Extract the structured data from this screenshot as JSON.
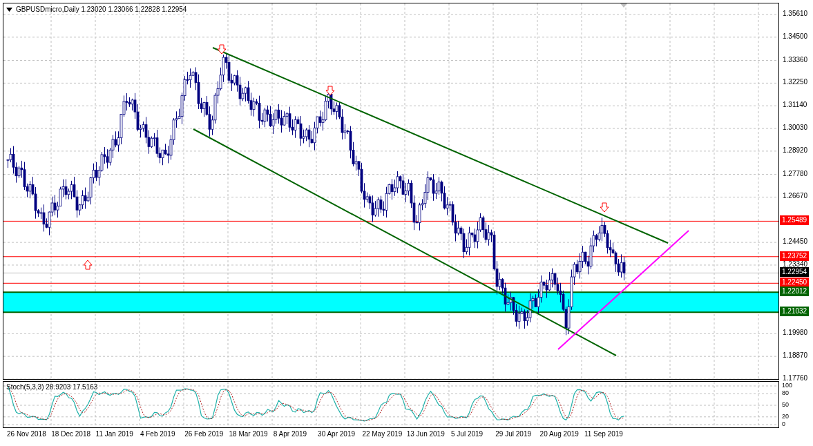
{
  "chart": {
    "title": "GBPUSDmicro,Daily  1.23020 1.23066 1.22828 1.22954",
    "price_axis": [
      "1.35610",
      "1.34500",
      "1.33360",
      "1.32250",
      "1.31140",
      "1.30030",
      "1.28920",
      "1.27780",
      "1.26670",
      "1.24450",
      "1.23340",
      "1.19980",
      "1.18870",
      "1.17760"
    ],
    "price_tags": [
      {
        "text": "1.25489",
        "kind": "level",
        "color": "#ff0000"
      },
      {
        "text": "1.23752",
        "kind": "level",
        "color": "#ff0000"
      },
      {
        "text": "1.22954",
        "kind": "bid",
        "color": "#000000"
      },
      {
        "text": "1.22450",
        "kind": "level",
        "color": "#ff0000"
      },
      {
        "text": "1.22012",
        "kind": "zone-top",
        "color": "#006400"
      },
      {
        "text": "1.21032",
        "kind": "zone-bottom",
        "color": "#006400"
      }
    ]
  },
  "indicator": {
    "title": "Stoch(5,3,3) 28.9203 17.5163",
    "axis": [
      "100",
      "80",
      "50",
      "20",
      "0"
    ]
  },
  "time_axis": [
    "26 Nov 2018",
    "18 Dec 2018",
    "11 Jan 2019",
    "4 Feb 2019",
    "26 Feb 2019",
    "18 Mar 2019",
    "8 Apr 2019",
    "30 Apr 2019",
    "22 May 2019",
    "13 Jun 2019",
    "5 Jul 2019",
    "29 Jul 2019",
    "20 Aug 2019",
    "11 Sep 2019"
  ]
}
